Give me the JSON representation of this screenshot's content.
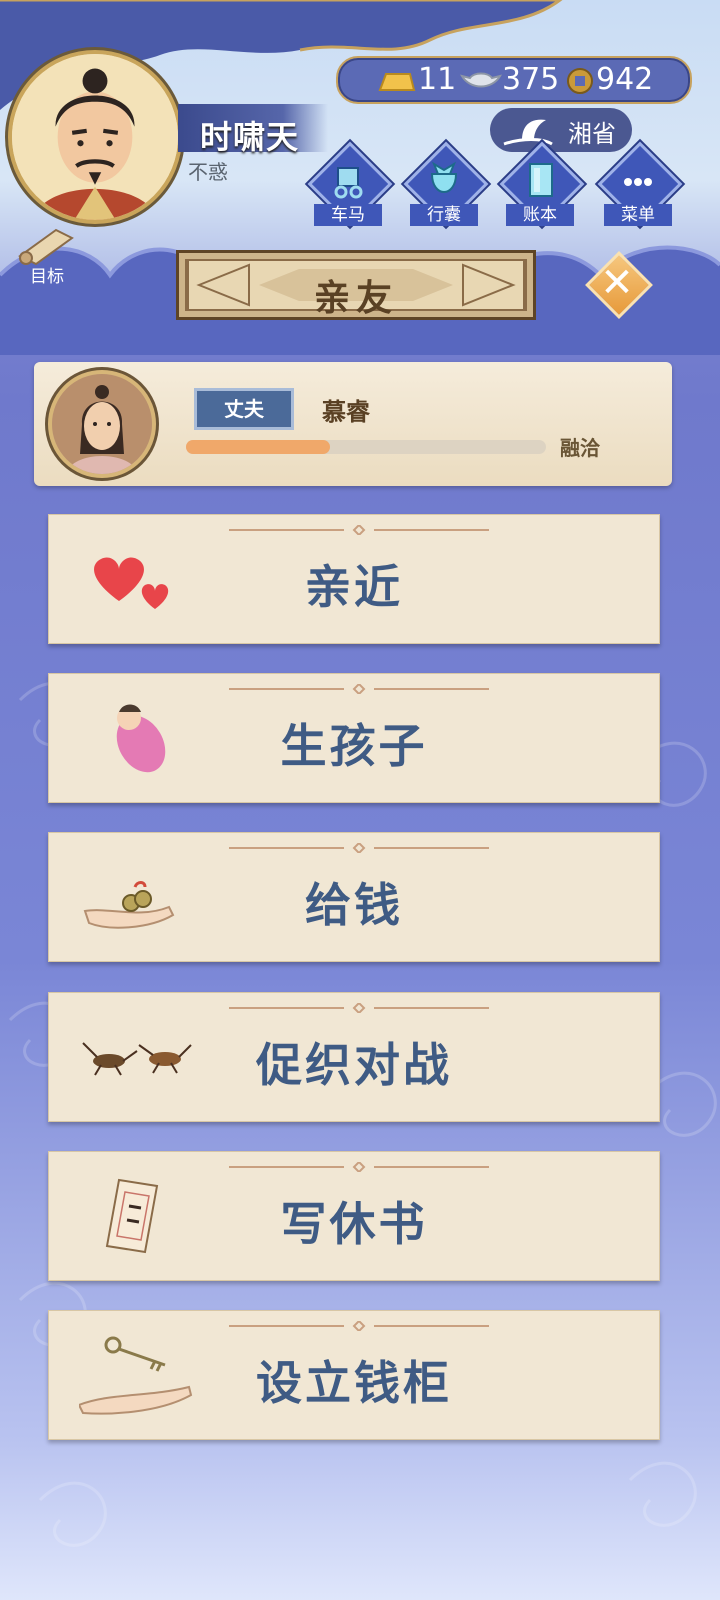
{
  "player": {
    "name": "时啸天",
    "age_title": "不惑"
  },
  "currency": {
    "gold": "11",
    "silver": "375",
    "coins": "942"
  },
  "region": "湘省",
  "menu": [
    {
      "label": "车马",
      "icon": "carriage-icon"
    },
    {
      "label": "行囊",
      "icon": "bag-icon"
    },
    {
      "label": "账本",
      "icon": "ledger-icon"
    },
    {
      "label": "菜单",
      "icon": "more-icon"
    }
  ],
  "goal_label": "目标",
  "panel_title": "亲友",
  "spouse": {
    "relation": "丈夫",
    "name": "慕睿",
    "affinity_label": "融洽",
    "affinity_fraction": 0.4
  },
  "actions": [
    {
      "label": "亲近",
      "icon": "hearts-icon"
    },
    {
      "label": "生孩子",
      "icon": "swaddled-baby-icon"
    },
    {
      "label": "给钱",
      "icon": "money-in-hand-icon"
    },
    {
      "label": "促织对战",
      "icon": "crickets-icon"
    },
    {
      "label": "写休书",
      "icon": "divorce-letter-icon"
    },
    {
      "label": "设立钱柜",
      "icon": "key-in-hand-icon"
    }
  ],
  "colors": {
    "accent_blue": "#3f57b8",
    "label_blue": "#3f5b84",
    "card": "#f1e7d4",
    "gold": "#c7a25e"
  }
}
